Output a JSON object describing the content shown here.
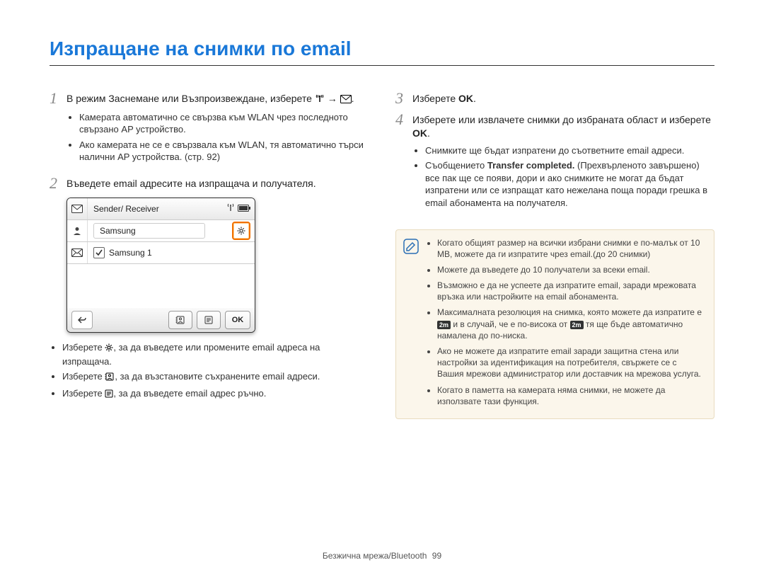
{
  "title": "Изпращане на снимки по email",
  "steps": {
    "s1": {
      "num": "1",
      "text_a": "В режим Заснемане или Възпроизвеждане, изберете",
      "text_b": " → ",
      "text_c": ".",
      "bullets": [
        "Камерата автоматично се свързва към WLAN чрез последното свързано AP устройство.",
        "Ако камерата не се е свързвала към WLAN, тя автоматично търси налични AP устройства. (стр. 92)"
      ]
    },
    "s2": {
      "num": "2",
      "text": "Въведете email адресите на изпращача и получателя.",
      "bullets_after": {
        "b1_a": "Изберете ",
        "b1_b": ", за да въведете или промените email адреса на изпращача.",
        "b2_a": "Изберете ",
        "b2_b": ", за да възстановите съхранените email адреси.",
        "b3_a": "Изберете ",
        "b3_b": ", за да въведете email адрес ръчно."
      }
    },
    "s3": {
      "num": "3",
      "text_a": "Изберете ",
      "ok": "OK",
      "text_b": "."
    },
    "s4": {
      "num": "4",
      "text_a": "Изберете или извлачете снимки до избраната област и изберете ",
      "ok": "OK",
      "text_b": ".",
      "bullets": {
        "b1": "Снимките ще бъдат изпратени до съответните email адреси.",
        "b2_a": "Съобщението ",
        "b2_bold": "Transfer completed.",
        "b2_b": " (Прехвърленото завършено) все пак ще се появи, дори и ако снимките не могат да бъдат изпратени или се изпращат като нежелана поща поради грешка в email абонамента на получателя."
      }
    }
  },
  "camera_ui": {
    "header": "Sender/ Receiver",
    "row1": "Samsung",
    "row2": "Samsung 1",
    "ok_btn": "OK"
  },
  "info_notes": {
    "n1": "Когато общият размер на всички избрани снимки е по-малък от 10 MB, можете да ги изпратите чрез email.(до 20 снимки)",
    "n2": "Можете да въведете до 10 получатели за всеки email.",
    "n3": "Възможно е да не успеете да изпратите email, заради мрежовата връзка или настройките на email абонамента.",
    "n4_a": "Максималната резолюция на снимка, която можете да изпратите е ",
    "n4_b": " и в случай, че е по-висока от ",
    "n4_c": " тя ще бъде автоматично намалена до по-ниска.",
    "n5": "Ако не можете да изпратите email заради защитна стена или настройки за идентификация на потребителя, свържете се с Вашия мрежови администратор или доставчик на мрежова услуга.",
    "n6": "Когато в паметта на камерата няма снимки, не можете да използвате тази функция."
  },
  "footer": {
    "section": "Безжична мрежа/Bluetooth",
    "page": "99"
  },
  "badge_2m": "2m"
}
